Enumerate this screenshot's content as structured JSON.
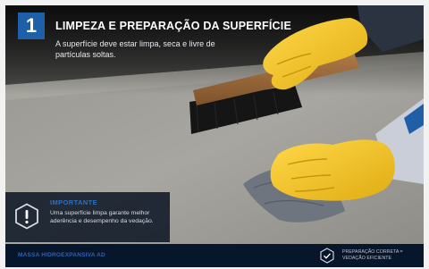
{
  "step": "1",
  "title": "LIMPEZA E PREPARAÇÃO DA SUPERFÍCIE",
  "subtitle": "A superfície deve estar limpa, seca e livre de partículas soltas.",
  "important": {
    "heading": "IMPORTANTE",
    "text": "Uma superfície limpa garante melhor aderência e desempenho da vedação."
  },
  "footer": {
    "brand": "MASSA HIDROEXPANSIVA AD",
    "cta": "PREPARAÇÃO CORRETA = VEDAÇÃO EFICIENTE"
  },
  "icons": {
    "warning": "exclamation-hexagon-icon",
    "check": "check-hexagon-icon"
  },
  "colors": {
    "accent": "#1f5fa8",
    "glove": "#f2c319",
    "panel": "#081221",
    "footer": "#07162a"
  }
}
